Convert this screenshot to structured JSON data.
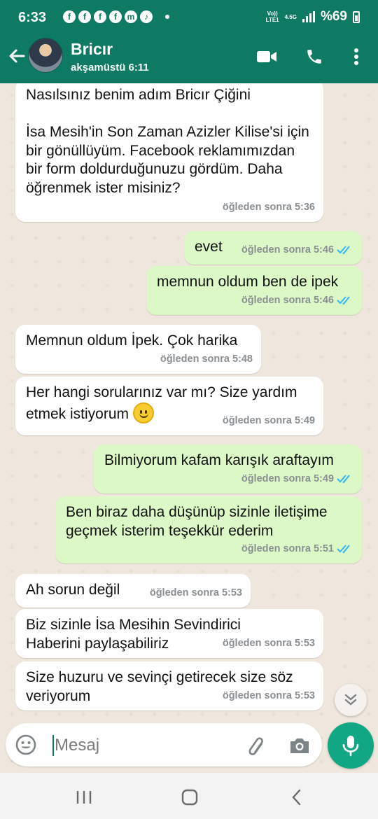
{
  "status_bar": {
    "time": "6:33",
    "network_top": "Vo))",
    "network_bottom": "LTE1",
    "network_type": "4.5G",
    "battery": "%69"
  },
  "header": {
    "contact_name": "Bricır",
    "contact_status": "akşamüstü 6:11",
    "icons": [
      "back-arrow-icon",
      "video-call-icon",
      "voice-call-icon",
      "more-options-icon"
    ]
  },
  "messages": [
    {
      "dir": "in",
      "text": "Nasılsınız benim adım Bricır Çiğini\n\nİsa Mesih'in Son Zaman Azizler Kilise'si için bir gönüllüyüm. Facebook reklamımızdan bir form doldurduğunuzu gördüm. Daha öğrenmek ister misiniz?",
      "time": "öğleden sonra 5:36"
    },
    {
      "dir": "out",
      "text": "evet",
      "time": "öğleden sonra 5:46",
      "read": true
    },
    {
      "dir": "out",
      "text": "memnun oldum ben de ipek",
      "time": "öğleden sonra 5:46",
      "read": true
    },
    {
      "dir": "in",
      "text": "Memnun oldum İpek. Çok harika",
      "time": "öğleden sonra 5:48"
    },
    {
      "dir": "in",
      "text": "Her hangi sorularınız var mı? Size yardım etmek istiyorum",
      "emoji": "slightly-smiling-face",
      "time": "öğleden sonra 5:49"
    },
    {
      "dir": "out",
      "text": "Bilmiyorum kafam karışık araftayım",
      "time": "öğleden sonra 5:49",
      "read": true
    },
    {
      "dir": "out",
      "text": "Ben biraz daha düşünüp sizinle iletişime geçmek isterim teşekkür ederim",
      "time": "öğleden sonra 5:51",
      "read": true
    },
    {
      "dir": "in",
      "text": "Ah sorun değil",
      "time": "öğleden sonra 5:53"
    },
    {
      "dir": "in",
      "text": "Biz sizinle İsa Mesihin Sevindirici Haberini paylaşabiliriz",
      "time": "öğleden sonra 5:53"
    },
    {
      "dir": "in",
      "text": "Size huzuru ve sevinçi getirecek size söz veriyorum",
      "time": "öğleden sonra 5:53"
    }
  ],
  "composer": {
    "placeholder": "Mesaj"
  },
  "colors": {
    "header": "#0f7a63",
    "outgoing_bubble": "#dcf8c6",
    "incoming_bubble": "#ffffff",
    "read_ticks": "#34b7f1",
    "mic_button": "#12a784"
  }
}
